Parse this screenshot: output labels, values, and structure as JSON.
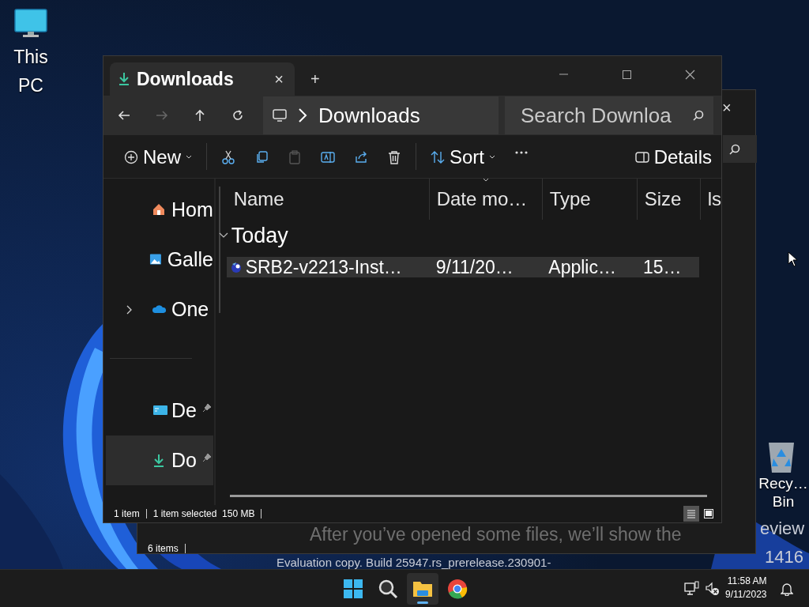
{
  "desktop": {
    "icons": [
      {
        "kind": "pc",
        "label": "This PC"
      },
      {
        "kind": "recycle",
        "label": "Recy… Bin"
      }
    ],
    "watermark": [
      "eview",
      "1416",
      "Evaluation copy. Build 25947.rs_prerelease.230901-"
    ]
  },
  "back_window": {
    "close": "×",
    "empty_message": "After you’ve opened some files, we’ll show the",
    "status": "6 items"
  },
  "window": {
    "tabs": [
      {
        "title": "Downloads",
        "close": "×",
        "selected": true
      }
    ],
    "new_tab": "+",
    "nav_buttons": [
      {
        "kind": "back",
        "disabled": false
      },
      {
        "kind": "forward",
        "disabled": true
      },
      {
        "kind": "up",
        "disabled": false
      },
      {
        "kind": "refresh",
        "disabled": false
      }
    ],
    "address": {
      "segments": [
        "Downloads"
      ]
    },
    "search": {
      "placeholder": "Search Downloa"
    },
    "toolbar": [
      {
        "kind": "new",
        "label": "New",
        "disabled": false
      },
      {
        "kind": "cut",
        "disabled": false
      },
      {
        "kind": "copy",
        "disabled": false
      },
      {
        "kind": "paste",
        "disabled": true
      },
      {
        "kind": "rename",
        "disabled": false
      },
      {
        "kind": "share",
        "disabled": false
      },
      {
        "kind": "delete",
        "disabled": false
      },
      {
        "kind": "sort",
        "label": "Sort",
        "disabled": false
      },
      {
        "kind": "more",
        "disabled": false
      },
      {
        "kind": "details",
        "label": "Details",
        "disabled": false
      }
    ],
    "sidebar": {
      "sections": [
        {
          "items": [
            {
              "kind": "home",
              "label": "Hom",
              "selected": false,
              "pinned": false,
              "expandable": false
            },
            {
              "kind": "gallery",
              "label": "Galle",
              "selected": false,
              "pinned": false,
              "expandable": false
            },
            {
              "kind": "cloud",
              "label": "One",
              "selected": false,
              "pinned": false,
              "expandable": true
            }
          ]
        },
        {
          "items": [
            {
              "kind": "desktop",
              "label": "De",
              "selected": false,
              "pinned": true,
              "expandable": false
            },
            {
              "kind": "download",
              "label": "Do",
              "selected": true,
              "pinned": true,
              "expandable": false
            }
          ]
        }
      ]
    },
    "columns": [
      "Name",
      "Date mo…",
      "Type",
      "Size",
      "ls"
    ],
    "groups": [
      {
        "label": "Today",
        "expanded": true,
        "rows": [
          {
            "name": "SRB2-v2213-Inst…",
            "date": "9/11/20…",
            "type": "Applic…",
            "size": "15…",
            "selected": true
          }
        ]
      }
    ],
    "status": {
      "count": "1 item",
      "selection": "1 item selected",
      "size": "150 MB"
    },
    "views": [
      {
        "kind": "details",
        "selected": true
      },
      {
        "kind": "tiles",
        "selected": false
      }
    ]
  },
  "taskbar": {
    "apps": [
      {
        "kind": "start",
        "selected": false
      },
      {
        "kind": "search",
        "selected": false
      },
      {
        "kind": "explorer",
        "selected": true
      },
      {
        "kind": "chrome",
        "selected": false
      }
    ],
    "tray": {
      "time": "11:58 AM",
      "date": "9/11/2023"
    }
  }
}
